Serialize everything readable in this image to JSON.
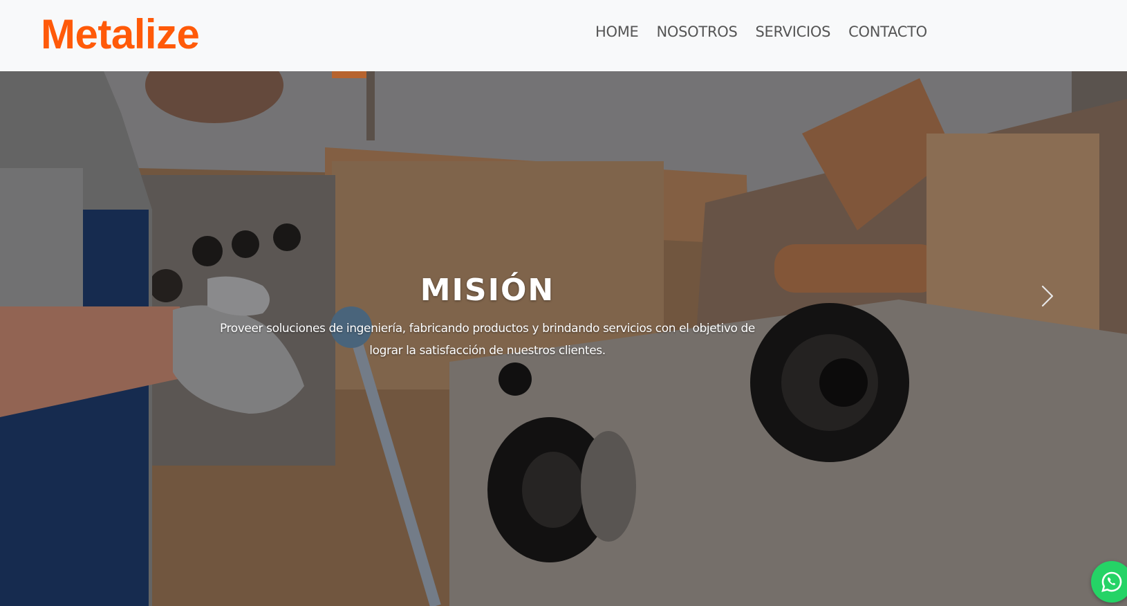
{
  "brand": {
    "name": "Metalize",
    "color": "#ff5a09"
  },
  "nav": {
    "items": [
      {
        "label": "HOME"
      },
      {
        "label": "NOSOTROS"
      },
      {
        "label": "SERVICIOS"
      },
      {
        "label": "CONTACTO"
      }
    ]
  },
  "hero": {
    "slide_title": "MISIÓN",
    "slide_text": "Proveer soluciones de ingeniería, fabricando productos y brindando servicios con el objetivo de lograr la satisfacción de nuestros clientes.",
    "next_icon": "chevron-right-icon"
  },
  "floating": {
    "whatsapp_icon": "whatsapp-icon",
    "color": "#25d366"
  }
}
